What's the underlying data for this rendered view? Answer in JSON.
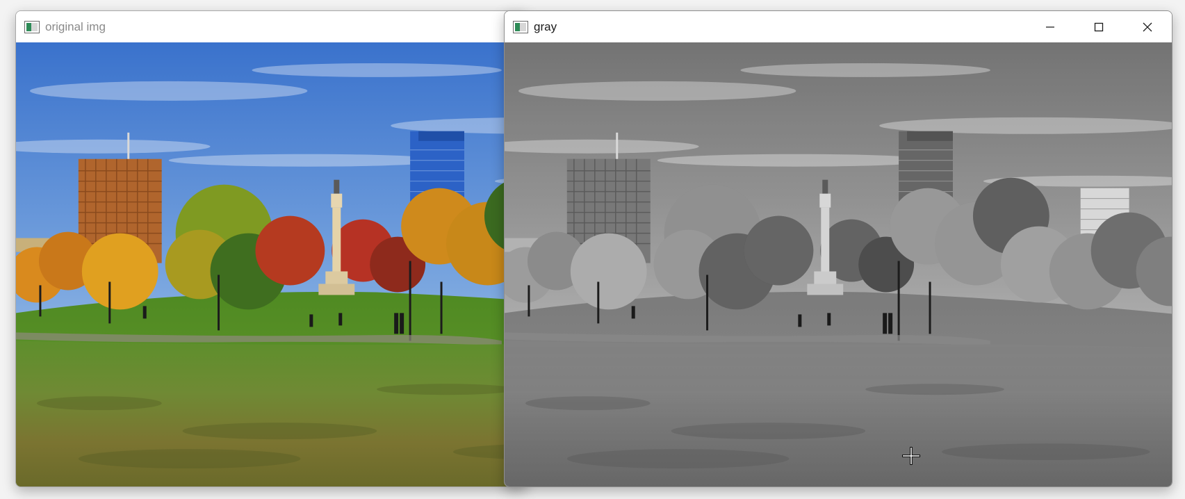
{
  "windows": {
    "original": {
      "title": "original img"
    },
    "gray": {
      "title": "gray",
      "buttons": {
        "minimize": "minimize-icon",
        "maximize": "maximize-icon",
        "close": "close-icon"
      }
    }
  },
  "colors": {
    "title_active": "#1a1a1a",
    "title_inactive": "#8a8a8a",
    "sky_top": "#3f78d0",
    "grass": "#5d8a2e",
    "autumn_orange": "#d98a1e",
    "autumn_red": "#b53a20"
  },
  "cursor": "crosshair-cursor-icon"
}
